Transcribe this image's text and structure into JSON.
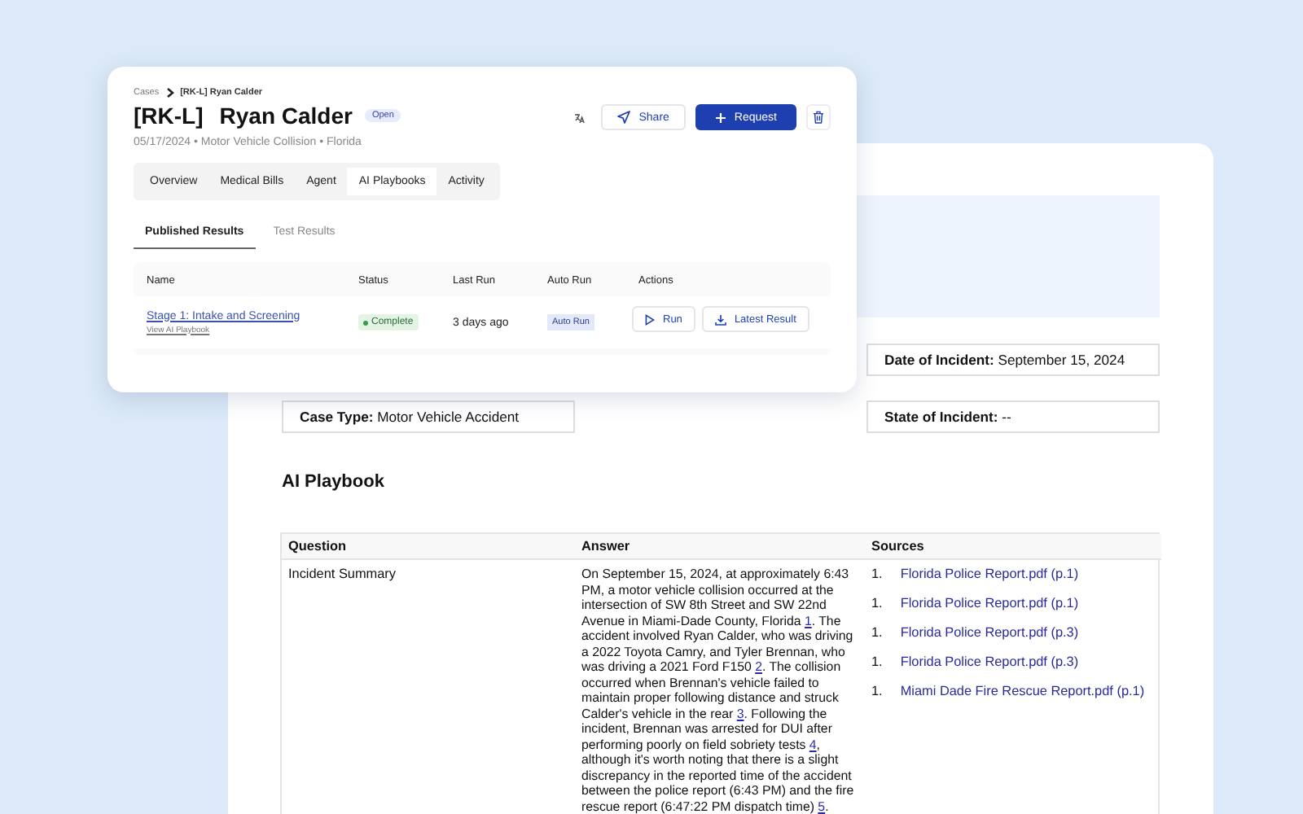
{
  "document": {
    "fields": [
      {
        "label": "Date of Incident:",
        "value": "September 15, 2024"
      },
      {
        "label": "Case Type:",
        "value": "Motor Vehicle Accident"
      },
      {
        "label": "State of Incident:",
        "value": "--"
      }
    ],
    "section_title": "AI Playbook",
    "table": {
      "columns": [
        "Question",
        "Answer",
        "Sources"
      ],
      "rows": [
        {
          "question": "Incident Summary",
          "answer": [
            {
              "kind": "text",
              "text": "On September 15, 2024, at approximately 6:43 PM, a motor vehicle collision occurred at the intersection of SW 8th Street and SW 22nd Avenue in Miami-Dade County, Florida "
            },
            {
              "kind": "citation",
              "text": "1"
            },
            {
              "kind": "text",
              "text": ". The accident involved Ryan Calder, who was driving a 2022 Toyota Camry, and Tyler Brennan, who was driving a 2021 Ford F150 "
            },
            {
              "kind": "citation",
              "text": "2"
            },
            {
              "kind": "text",
              "text": ". The collision occurred when Brennan's vehicle failed to maintain proper following distance and struck Calder's vehicle in the rear "
            },
            {
              "kind": "citation",
              "text": "3"
            },
            {
              "kind": "text",
              "text": ". Following the incident, Brennan was arrested for DUI after performing poorly on field sobriety tests "
            },
            {
              "kind": "citation",
              "text": "4"
            },
            {
              "kind": "text",
              "text": ", although it's worth noting that there is a slight discrepancy in the reported time of the accident between the police report (6:43 PM) and the fire rescue report (6:47:22 PM dispatch time) "
            },
            {
              "kind": "citation",
              "text": "5"
            },
            {
              "kind": "text",
              "text": "."
            }
          ],
          "sources": [
            {
              "number": "1.",
              "title": "Florida Police Report.pdf (p.1)"
            },
            {
              "number": "1.",
              "title": "Florida Police Report.pdf (p.1)"
            },
            {
              "number": "1.",
              "title": "Florida Police Report.pdf (p.3)"
            },
            {
              "number": "1.",
              "title": "Florida Police Report.pdf (p.3)"
            },
            {
              "number": "1.",
              "title": "Miami Dade Fire Rescue Report.pdf (p.1)"
            }
          ]
        }
      ]
    }
  },
  "case_card": {
    "breadcrumb": [
      "Cases",
      "[RK-L] Ryan Calder"
    ],
    "code": "[RK-L]",
    "name": "Ryan Calder",
    "status": "Open",
    "meta": "05/17/2024 • Motor Vehicle Collision • Florida",
    "buttons": {
      "share": "Share",
      "request": "Request"
    },
    "tabs": [
      {
        "label": "Overview",
        "selected": false
      },
      {
        "label": "Medical Bills",
        "selected": false
      },
      {
        "label": "Agent",
        "selected": false
      },
      {
        "label": "AI Playbooks",
        "selected": true
      },
      {
        "label": "Activity",
        "selected": false
      }
    ],
    "subtabs": [
      {
        "label": "Published Results",
        "selected": true
      },
      {
        "label": "Test Results",
        "selected": false
      }
    ],
    "table": {
      "columns": [
        "Name",
        "Status",
        "Last Run",
        "Auto Run",
        "Actions"
      ],
      "rows": [
        {
          "name": "Stage 1: Intake and Screening",
          "link": "View AI Playbook",
          "status": "Complete",
          "last_run": "3 days ago",
          "auto_run": "Auto Run",
          "actions": [
            "Run",
            "Latest Result"
          ]
        }
      ]
    }
  }
}
